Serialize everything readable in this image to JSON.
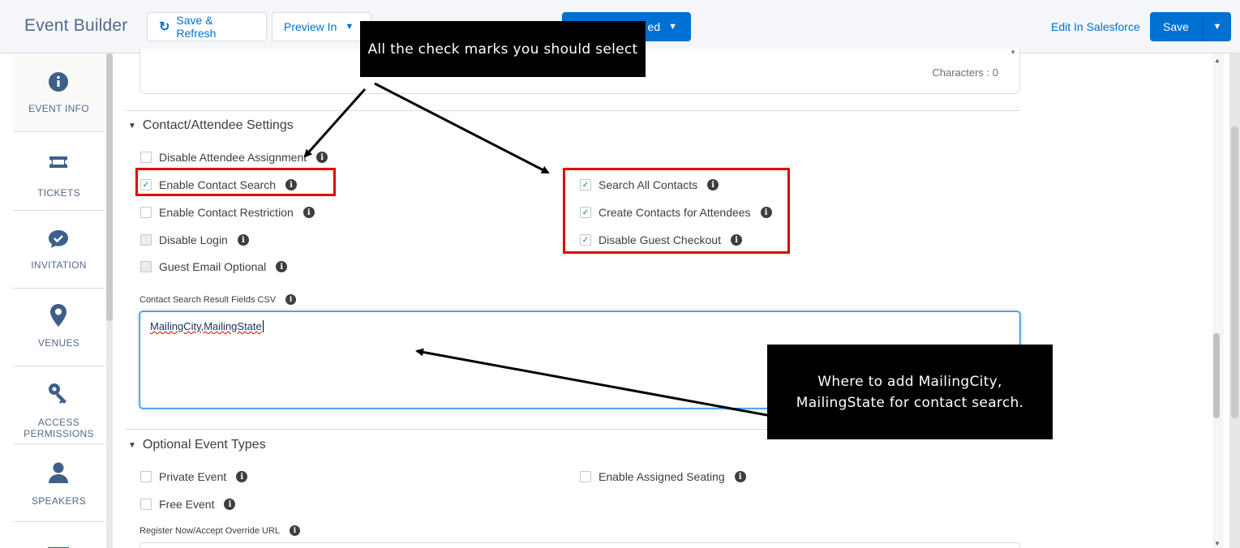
{
  "header": {
    "app_title": "Event Builder",
    "save_refresh_label": "Save & Refresh",
    "preview_label": "Preview In",
    "published_label": "ed",
    "edit_in_salesforce": "Edit In Salesforce",
    "save_label": "Save"
  },
  "sidebar": {
    "items": [
      {
        "label": "EVENT INFO",
        "icon": "info-icon"
      },
      {
        "label": "TICKETS",
        "icon": "ticket-icon"
      },
      {
        "label": "INVITATION",
        "icon": "chat-check-icon"
      },
      {
        "label": "VENUES",
        "icon": "location-pin-icon"
      },
      {
        "label": "ACCESS PERMISSIONS",
        "icon": "key-icon"
      },
      {
        "label": "SPEAKERS",
        "icon": "person-icon"
      }
    ]
  },
  "description": {
    "characters_label": "Characters : 0"
  },
  "contact_settings": {
    "title": "Contact/Attendee Settings",
    "left_checkboxes": [
      {
        "label": "Disable Attendee Assignment",
        "checked": false
      },
      {
        "label": "Enable Contact Search",
        "checked": true
      },
      {
        "label": "Enable Contact Restriction",
        "checked": false
      },
      {
        "label": "Disable Login",
        "checked": false
      },
      {
        "label": "Guest Email Optional",
        "checked": false
      }
    ],
    "right_checkboxes": [
      {
        "label": "Search All Contacts",
        "checked": true
      },
      {
        "label": "Create Contacts for Attendees",
        "checked": true
      },
      {
        "label": "Disable Guest Checkout",
        "checked": true
      }
    ],
    "csv_label": "Contact Search Result Fields CSV",
    "csv_value": "MailingCity,MailingState"
  },
  "optional_event_types": {
    "title": "Optional Event Types",
    "checkboxes": [
      {
        "label": "Private Event",
        "checked": false
      },
      {
        "label": "Enable Assigned Seating",
        "checked": false
      },
      {
        "label": "Free Event",
        "checked": false
      }
    ],
    "override_url_label": "Register Now/Accept Override URL"
  },
  "annotations": {
    "top_callout": "All the check marks you should select",
    "bottom_callout": "Where to add MailingCity, MailingState for contact search.",
    "highlight_color": "#e00000"
  },
  "colors": {
    "brand_blue": "#0070d2",
    "sidebar_icon": "#3e5f8a"
  }
}
